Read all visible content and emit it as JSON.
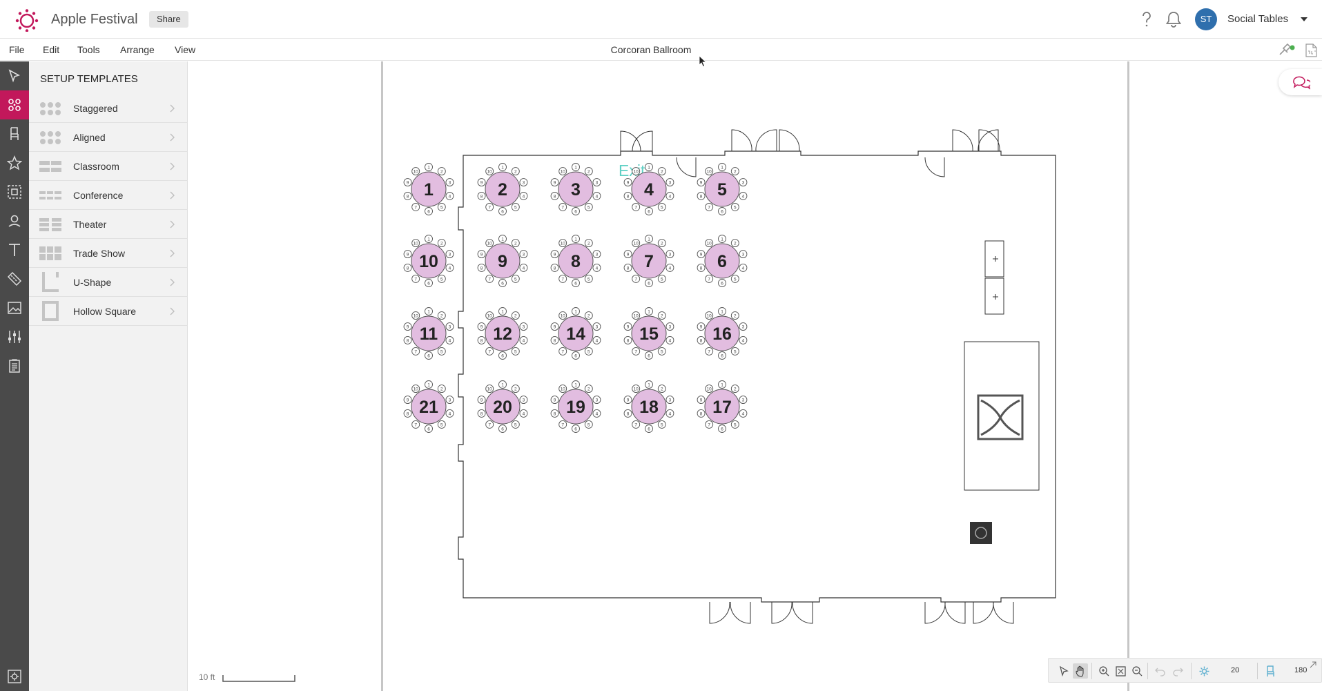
{
  "app": {
    "title": "Apple Festival",
    "share_label": "Share"
  },
  "user": {
    "initials": "ST",
    "name": "Social Tables"
  },
  "menu": {
    "items": [
      "File",
      "Edit",
      "Tools",
      "Arrange",
      "View"
    ],
    "document_title": "Corcoran Ballroom"
  },
  "templates": {
    "title": "SETUP TEMPLATES",
    "items": [
      "Staggered",
      "Aligned",
      "Classroom",
      "Conference",
      "Theater",
      "Trade Show",
      "U-Shape",
      "Hollow Square"
    ]
  },
  "floorplan": {
    "exit_label": "Exit",
    "table_rows": [
      [
        "1",
        "2",
        "3",
        "4",
        "5"
      ],
      [
        "10",
        "9",
        "8",
        "7",
        "6"
      ],
      [
        "11",
        "12",
        "14",
        "15",
        "16"
      ],
      [
        "21",
        "20",
        "19",
        "18",
        "17"
      ]
    ],
    "seat_numbers": [
      "1",
      "2",
      "3",
      "4",
      "5",
      "6",
      "7",
      "8",
      "9",
      "10"
    ],
    "table_color": "#e2bde0"
  },
  "scale": {
    "label": "10 ft"
  },
  "toolbar": {
    "grid_value": "20",
    "chairs_value": "180"
  },
  "colors": {
    "accent": "#c2185b",
    "rail": "#4a4a4a",
    "avatar": "#2f6fad"
  },
  "icons": {
    "rail": [
      "pointer-icon",
      "tables-icon",
      "chair-icon",
      "star-icon",
      "select-area-icon",
      "location-pin-icon",
      "text-icon",
      "ruler-icon",
      "image-icon",
      "sliders-icon",
      "clipboard-icon",
      "settings-icon"
    ]
  }
}
